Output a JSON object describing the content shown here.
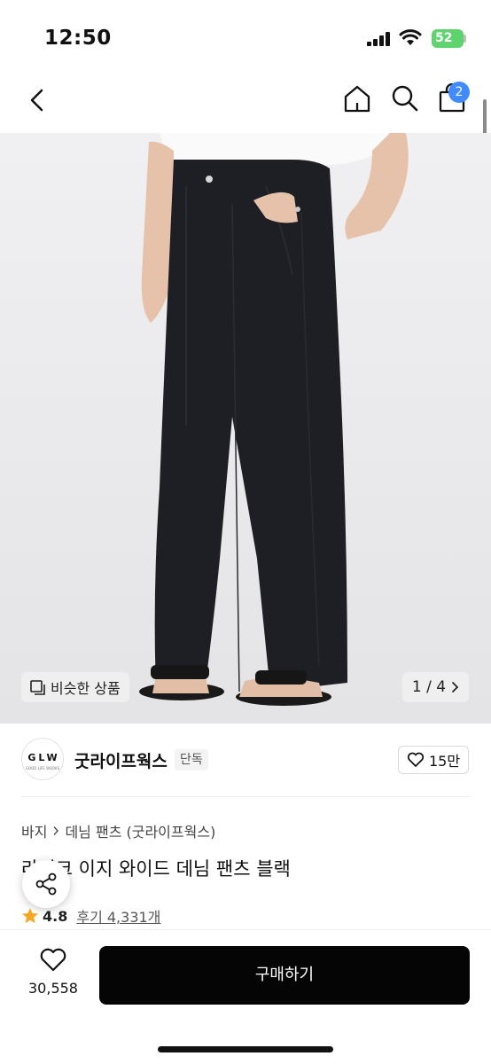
{
  "status_bar": {
    "time": "12:50",
    "battery": "52"
  },
  "nav": {
    "cart_count": "2"
  },
  "hero": {
    "similar_label": "비슷한 상품",
    "page_indicator": "1 / 4"
  },
  "brand": {
    "logo_text": "GLW",
    "logo_subtext": "GOOD LIFE WORKS",
    "name": "굿라이프웍스",
    "tag": "단독",
    "likes": "15만"
  },
  "breadcrumb": [
    "바지",
    "데님 팬츠 (굿라이프웍스)"
  ],
  "product": {
    "title": "라이크 이지 와이드 데님 팬츠 블랙",
    "rating": "4.8",
    "reviews": "후기 4,331개"
  },
  "bottom": {
    "favorite_count": "30,558",
    "buy_label": "구매하기"
  },
  "colors": {
    "accent_badge": "#3f8bff",
    "star": "#f5a623",
    "buy_button": "#050505",
    "battery": "#5fd36d"
  }
}
